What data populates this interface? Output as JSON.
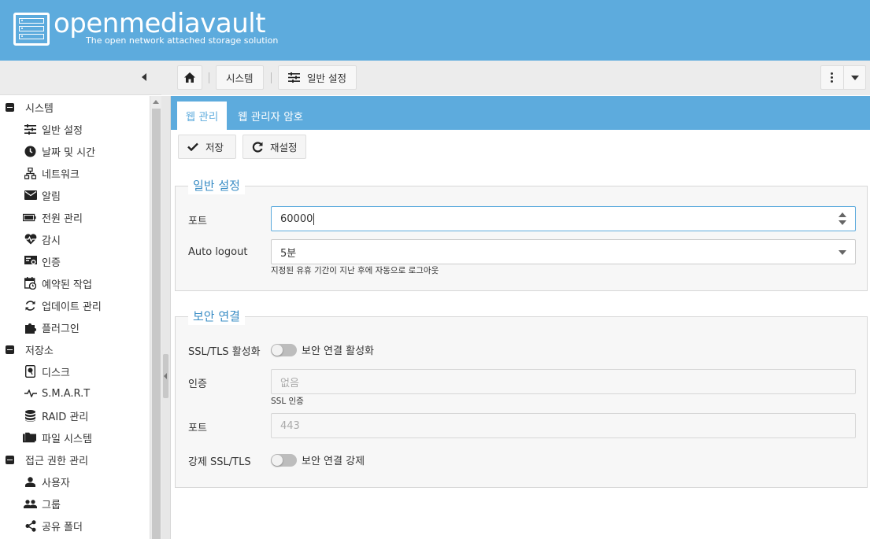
{
  "header": {
    "logo_text": "openmediavault",
    "tagline": "The open network attached storage solution",
    "brand_color": "#5dabdd"
  },
  "breadcrumb": {
    "home_icon": "home-icon",
    "items": [
      {
        "label": "시스템"
      },
      {
        "label": "일반 설정",
        "icon": "sliders-icon"
      }
    ]
  },
  "toolbar_menu": {
    "icon": "vertical-dots-icon",
    "caret_icon": "chevron-down-icon"
  },
  "sidebar": {
    "groups": [
      {
        "label": "시스템",
        "items": [
          {
            "label": "일반 설정",
            "icon": "sliders-icon"
          },
          {
            "label": "날짜 및 시간",
            "icon": "clock-icon"
          },
          {
            "label": "네트워크",
            "icon": "network-icon"
          },
          {
            "label": "알림",
            "icon": "mail-icon"
          },
          {
            "label": "전원 관리",
            "icon": "battery-icon"
          },
          {
            "label": "감시",
            "icon": "heart-pulse-icon"
          },
          {
            "label": "인증",
            "icon": "certificate-icon"
          },
          {
            "label": "예약된 작업",
            "icon": "calendar-clock-icon"
          },
          {
            "label": "업데이트 관리",
            "icon": "refresh-icon"
          },
          {
            "label": "플러그인",
            "icon": "puzzle-icon"
          }
        ]
      },
      {
        "label": "저장소",
        "items": [
          {
            "label": "디스크",
            "icon": "disk-icon"
          },
          {
            "label": "S.M.A.R.T",
            "icon": "pulse-icon"
          },
          {
            "label": "RAID 관리",
            "icon": "database-icon"
          },
          {
            "label": "파일 시스템",
            "icon": "folder-icon"
          }
        ]
      },
      {
        "label": "접근 권한 관리",
        "items": [
          {
            "label": "사용자",
            "icon": "user-icon"
          },
          {
            "label": "그룹",
            "icon": "users-icon"
          },
          {
            "label": "공유 폴더",
            "icon": "share-icon"
          }
        ]
      }
    ]
  },
  "tabs": [
    {
      "label": "웹 관리",
      "active": true
    },
    {
      "label": "웹 관리자 암호",
      "active": false
    }
  ],
  "actions": {
    "save_label": "저장",
    "reset_label": "재설정"
  },
  "general": {
    "legend": "일반 설정",
    "port_label": "포트",
    "port_value": "60000",
    "autologout_label": "Auto logout",
    "autologout_value": "5분",
    "autologout_hint": "지정된 유휴 기간이 지난 후에 자동으로 로그아웃"
  },
  "secure": {
    "legend": "보안 연결",
    "ssl_label": "SSL/TLS 활성화",
    "ssl_toggle_label": "보안 연결 활성화",
    "cert_label": "인증",
    "cert_placeholder": "없음",
    "cert_hint": "SSL 인증",
    "port_label": "포트",
    "port_placeholder": "443",
    "force_label": "강제 SSL/TLS",
    "force_toggle_label": "보안 연결 강제"
  }
}
